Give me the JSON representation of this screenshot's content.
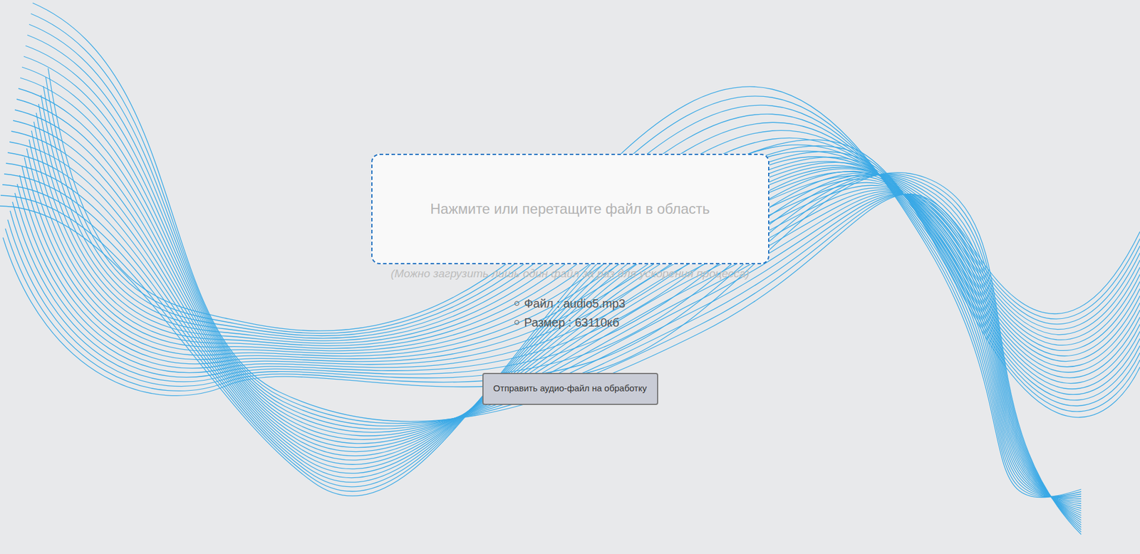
{
  "dropzone": {
    "text": "Нажмите или перетащите файл в область"
  },
  "hint": "(Можно загрузить лишь один файл за раз для ускорения процесса)",
  "file_info": [
    "Файл : audio5.mp3",
    "Размер : 63110кб"
  ],
  "buttons": [
    "Отправить аудио-файл на обработку"
  ]
}
